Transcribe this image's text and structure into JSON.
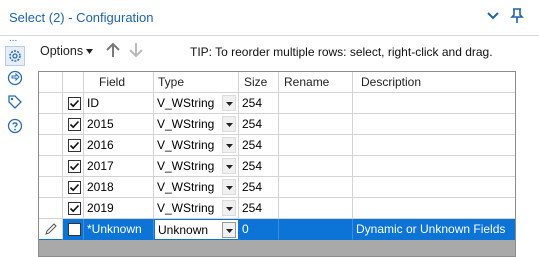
{
  "window": {
    "title": "Select (2) - Configuration"
  },
  "sidebar": {
    "overflow_dots": "...",
    "icons": [
      "settings-icon",
      "navigate-icon",
      "tag-icon",
      "help-icon"
    ]
  },
  "toolbar": {
    "options_label": "Options",
    "tip": "TIP: To reorder multiple rows: select, right-click and drag."
  },
  "grid": {
    "columns": [
      "Field",
      "Type",
      "Size",
      "Rename",
      "Description"
    ],
    "rows": [
      {
        "checked": true,
        "field": "ID",
        "type": "V_WString",
        "size": "254",
        "rename": "",
        "description": ""
      },
      {
        "checked": true,
        "field": "2015",
        "type": "V_WString",
        "size": "254",
        "rename": "",
        "description": ""
      },
      {
        "checked": true,
        "field": "2016",
        "type": "V_WString",
        "size": "254",
        "rename": "",
        "description": ""
      },
      {
        "checked": true,
        "field": "2017",
        "type": "V_WString",
        "size": "254",
        "rename": "",
        "description": ""
      },
      {
        "checked": true,
        "field": "2018",
        "type": "V_WString",
        "size": "254",
        "rename": "",
        "description": ""
      },
      {
        "checked": true,
        "field": "2019",
        "type": "V_WString",
        "size": "254",
        "rename": "",
        "description": ""
      },
      {
        "checked": false,
        "field": "*Unknown",
        "type": "Unknown",
        "size": "0",
        "rename": "",
        "description": "Dynamic or Unknown Fields",
        "selected": true
      }
    ]
  },
  "colors": {
    "accent": "#1f63b0",
    "selection": "#0b74d6",
    "grid_background": "#a9a9a9"
  }
}
